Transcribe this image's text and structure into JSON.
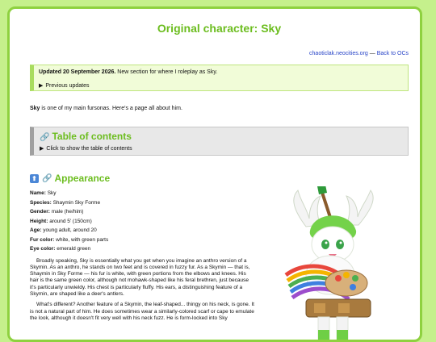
{
  "title": "Original character: Sky",
  "top_links": {
    "site": "chaoticlak.neocities.org",
    "sep": "—",
    "back": "Back to OCs"
  },
  "notice": {
    "bold": "Updated 20 September 2026.",
    "text": " New section for where I roleplay as Sky.",
    "details": "Previous updates"
  },
  "intro": {
    "name": "Sky",
    "text": " is one of my main fursonas. Here's a page all about him."
  },
  "toc": {
    "heading": "Table of contents",
    "details": "Click to show the table of contents"
  },
  "appearance": {
    "heading": "Appearance",
    "facts": [
      {
        "label": "Name:",
        "value": "Sky"
      },
      {
        "label": "Species:",
        "value": "Shaymin Sky Forme"
      },
      {
        "label": "Gender:",
        "value": "male (he/him)"
      },
      {
        "label": "Height:",
        "value": "around 5' (150cm)"
      },
      {
        "label": "Age:",
        "value": "young adult, around 20"
      },
      {
        "label": "Fur color:",
        "value": "white, with green parts"
      },
      {
        "label": "Eye color:",
        "value": "emerald green"
      }
    ],
    "para1": "Broadly speaking, Sky is essentially what you get when you imagine an anthro version of a Skymin. As an anthro, he stands on two feet and is covered in fuzzy fur. As a Skymin — that is, Shaymin in Sky Forme — his fur is white, with green portions from the elbows and knees. His hair is the same green color, although not mohawk-shaped like his feral brethren, just because it's particularly unwieldy. His chest is particularly fluffy. His ears, a distinguishing feature of a Skymin, are shaped like a deer's antlers.",
    "para2": "What's different? Another feature of a Skymin, the leaf-shaped... thingy on his neck, is gone. It is not a natural part of him. He does sometimes wear a similarly-colored scarf or cape to emulate the look, although it doesn't fit very well with his neck fuzz. He is form-locked into Sky"
  }
}
